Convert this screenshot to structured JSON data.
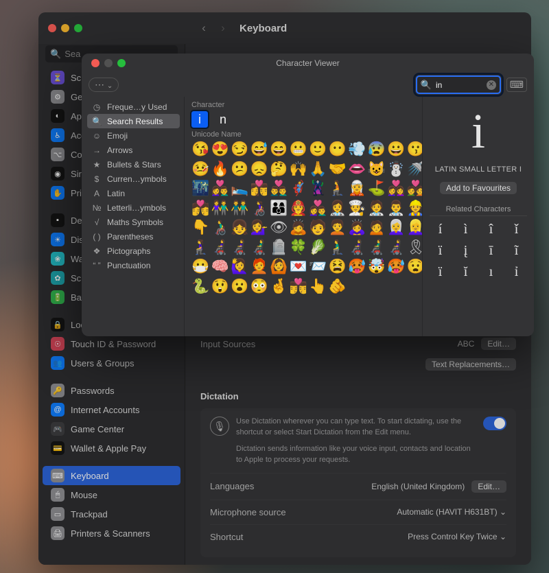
{
  "settings": {
    "title": "Keyboard",
    "search_placeholder": "Sea",
    "sidebar": [
      {
        "label": "Screen Time",
        "icon": "⏳",
        "bg": "#6a4fd9"
      },
      {
        "label": "General",
        "icon": "⚙︎",
        "bg": "#8e8e92"
      },
      {
        "label": "Appearance",
        "icon": "◐",
        "bg": "#111"
      },
      {
        "label": "Accessibility",
        "icon": "♿︎",
        "bg": "#0a7cff"
      },
      {
        "label": "Control Centre",
        "icon": "⌥",
        "bg": "#8e8e92"
      },
      {
        "label": "Siri & Spotlight",
        "icon": "◉",
        "bg": "#111"
      },
      {
        "label": "Privacy & Security",
        "icon": "✋",
        "bg": "#0a7cff"
      },
      {
        "label": "Desktop & Dock",
        "icon": "▪︎",
        "bg": "#111"
      },
      {
        "label": "Displays",
        "icon": "☀︎",
        "bg": "#0a7cff"
      },
      {
        "label": "Wallpaper",
        "icon": "❀",
        "bg": "#20bfc8"
      },
      {
        "label": "Screen Saver",
        "icon": "✿",
        "bg": "#1aa8b0"
      },
      {
        "label": "Battery",
        "icon": "🔋",
        "bg": "#2fb84c"
      },
      {
        "label": "Lock Screen",
        "icon": "🔒",
        "bg": "#111"
      },
      {
        "label": "Touch ID & Password",
        "icon": "☉",
        "bg": "#d64256"
      },
      {
        "label": "Users & Groups",
        "icon": "👥",
        "bg": "#0a7cff"
      },
      {
        "label": "Passwords",
        "icon": "🔑",
        "bg": "#8e8e92"
      },
      {
        "label": "Internet Accounts",
        "icon": "@",
        "bg": "#0a7cff"
      },
      {
        "label": "Game Center",
        "icon": "🎮",
        "bg": "#3a3a3c"
      },
      {
        "label": "Wallet & Apple Pay",
        "icon": "💳",
        "bg": "#111"
      },
      {
        "label": "Keyboard",
        "icon": "⌨︎",
        "bg": "#8e8e92"
      },
      {
        "label": "Mouse",
        "icon": "🖱",
        "bg": "#8e8e92"
      },
      {
        "label": "Trackpad",
        "icon": "▭",
        "bg": "#8e8e92"
      },
      {
        "label": "Printers & Scanners",
        "icon": "🖨",
        "bg": "#8e8e92"
      }
    ],
    "selected_sidebar": 19,
    "content": {
      "input_sources_label": "Input Sources",
      "input_sources_value": "ABC",
      "edit_button": "Edit…",
      "text_repl_button": "Text Replacements…",
      "dictation_heading": "Dictation",
      "dictation_desc1": "Use Dictation wherever you can type text. To start dictating, use the shortcut or select Start Dictation from the Edit menu.",
      "dictation_desc2": "Dictation sends information like your voice input, contacts and location to Apple to process your requests.",
      "languages_label": "Languages",
      "languages_value": "English (United Kingdom)",
      "mic_label": "Microphone source",
      "mic_value": "Automatic (HAVIT H631BT)",
      "shortcut_label": "Shortcut",
      "shortcut_value": "Press Control Key Twice"
    }
  },
  "char_viewer": {
    "title": "Character Viewer",
    "search_value": "in",
    "categories": [
      {
        "icon": "◷",
        "label": "Freque…y Used"
      },
      {
        "icon": "🔍",
        "label": "Search Results"
      },
      {
        "icon": "☺",
        "label": "Emoji"
      },
      {
        "icon": "→",
        "label": "Arrows"
      },
      {
        "icon": "★",
        "label": "Bullets & Stars"
      },
      {
        "icon": "$",
        "label": "Curren…ymbols"
      },
      {
        "icon": "A",
        "label": "Latin"
      },
      {
        "icon": "№",
        "label": "Letterli…ymbols"
      },
      {
        "icon": "√",
        "label": "Maths Symbols"
      },
      {
        "icon": "( )",
        "label": "Parentheses"
      },
      {
        "icon": "❖",
        "label": "Pictographs"
      },
      {
        "icon": "“ ”",
        "label": "Punctuation"
      }
    ],
    "selected_category": 1,
    "char_label": "Character",
    "unicode_label": "Unicode Name",
    "chars": [
      "i",
      "n"
    ],
    "selected_char": 0,
    "emojis": [
      "😘",
      "😍",
      "😏",
      "😅",
      "😄",
      "😬",
      "🙂",
      "😶",
      "💨",
      "😰",
      "😀",
      "😗",
      "🤒",
      "🔥",
      "😕",
      "😞",
      "🤔",
      "🙌",
      "🙏",
      "🤝",
      "👄",
      "😺",
      "☃️",
      "🚿",
      "🌃",
      "👩‍❤️‍👨",
      "🛌",
      "👩‍❤️‍💋‍👨",
      "👨‍❤️‍👨",
      "🦸",
      "🦹",
      "🧎",
      "🧝",
      "⛳",
      "👩‍❤️‍👩",
      "💑",
      "💏",
      "👫",
      "👬",
      "👩‍🦽",
      "👨‍👩‍👦",
      "🧑‍🚒",
      "👩‍❤️‍👨",
      "👩‍⚕️",
      "🧑‍🍳",
      "🧑‍⚕️",
      "👨‍⚕️",
      "👷",
      "👇",
      "👨‍🦽",
      "👧",
      "💁‍♀️",
      "👁",
      "🙇",
      "🧑",
      "🧑‍🦱",
      "🙇‍♀️",
      "🙍",
      "👩‍🦳",
      "👱‍♀️",
      "🧎‍♀️",
      "👩‍🦼",
      "👩‍🦼",
      "👨‍🦼",
      "🪦",
      "🍀",
      "🥬",
      "🧎‍♂️",
      "👩‍🦼",
      "👨‍🦼",
      "👩‍🦼",
      "🎗",
      "😷",
      "🧠",
      "🙋‍♀️",
      "🧑‍🦰",
      "🙆",
      "💌",
      "📨",
      "😫",
      "🥵",
      "🤯",
      "🥵",
      "😧",
      "🐍",
      "😲",
      "😮",
      "😳",
      "🤞",
      "👨‍❤️‍💋‍👨",
      "👆",
      "🫵"
    ],
    "preview": {
      "glyph": "i",
      "name": "LATIN SMALL LETTER I",
      "fav_button": "Add to Favourites",
      "related_heading": "Related Characters",
      "related": [
        "í",
        "ì",
        "î",
        "ǐ",
        "ï",
        "į",
        "ī",
        "ĩ",
        "ï",
        "ĭ",
        "ı",
        "ỉ"
      ]
    }
  }
}
